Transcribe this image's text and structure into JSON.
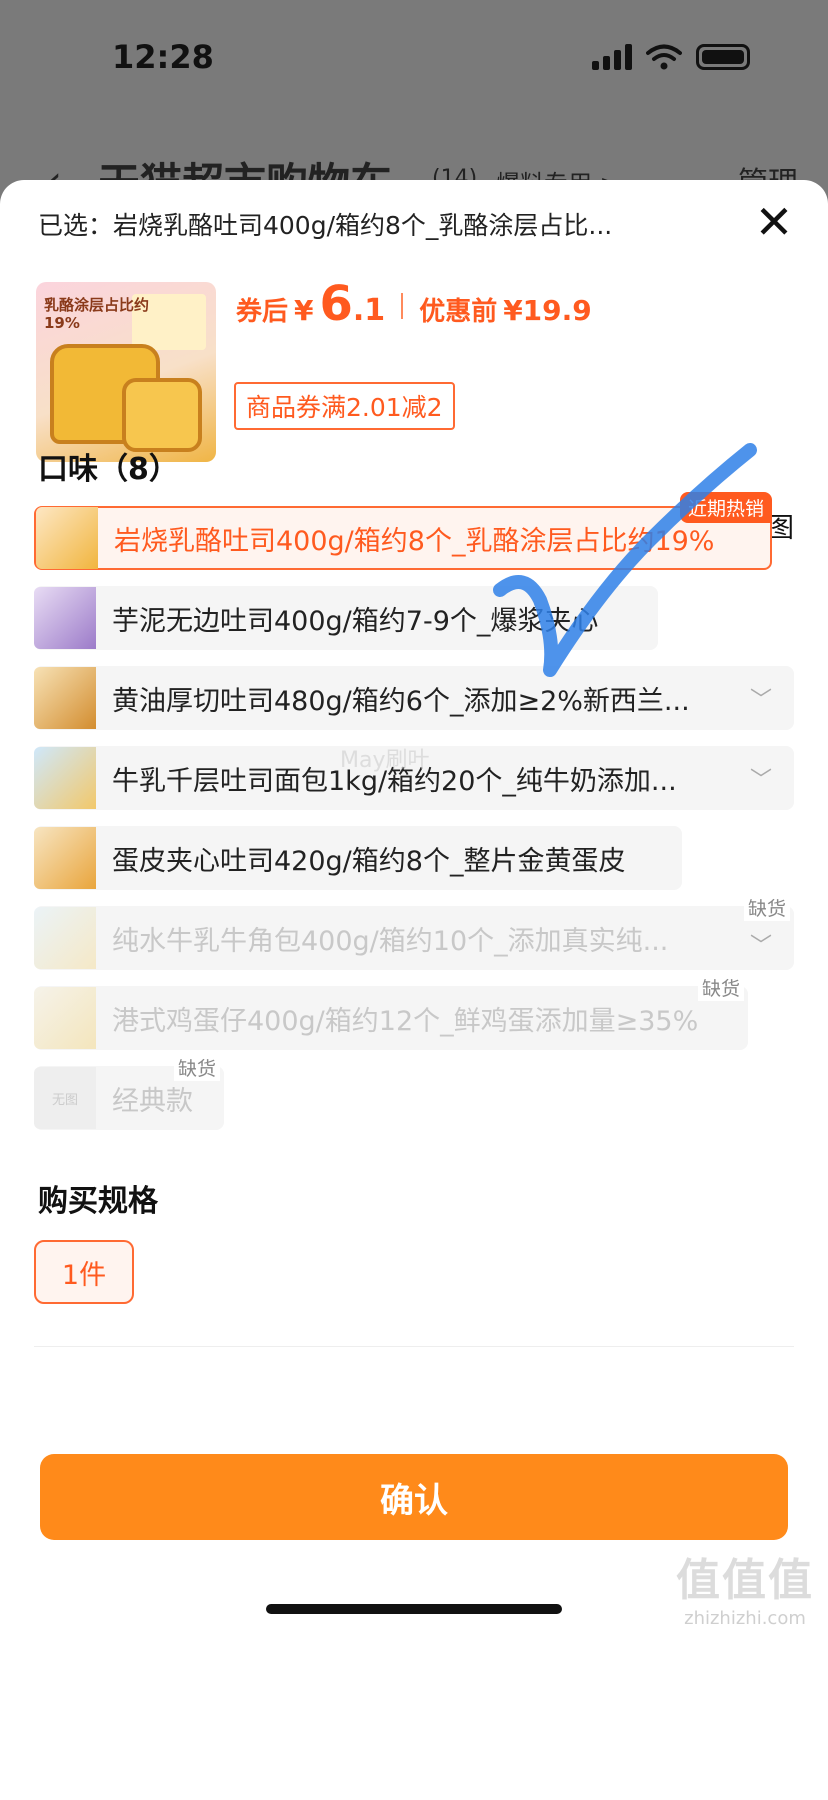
{
  "status_bar": {
    "time": "12:28"
  },
  "background_page": {
    "title": "天猫超市购物车",
    "count": "(14)",
    "location": "爆料专用 >",
    "manage": "管理"
  },
  "sheet": {
    "selected_text": "已选：岩烧乳酪吐司400g/箱约8个_乳酪涂层占比...",
    "close_icon": "close-icon",
    "product_thumb_text": "乳酪涂层占比约19%",
    "price": {
      "after_label": "券后",
      "currency": "¥",
      "after_int": "6",
      "after_dec": ".1",
      "before_label": "优惠前",
      "before_price": "¥19.9"
    },
    "coupon": "商品券满2.01减2",
    "flavor_section": {
      "title": "口味（8）",
      "big_image_label": "大图",
      "options": [
        {
          "label": "岩烧乳酪吐司400g/箱约8个_乳酪涂层占比约19%",
          "badge": "近期热销"
        },
        {
          "label": "芋泥无边吐司400g/箱约7-9个_爆浆夹心"
        },
        {
          "label": "黄油厚切吐司480g/箱约6个_添加≥2%新西兰..."
        },
        {
          "label": "牛乳千层吐司面包1kg/箱约20个_纯牛奶添加..."
        },
        {
          "label": "蛋皮夹心吐司420g/箱约8个_整片金黄蛋皮"
        },
        {
          "label": "纯水牛乳牛角包400g/箱约10个_添加真实纯...",
          "badge": "缺货"
        },
        {
          "label": "港式鸡蛋仔400g/箱约12个_鲜鸡蛋添加量≥35%",
          "badge": "缺货"
        },
        {
          "label": "经典款",
          "badge": "缺货",
          "thumb_text": "无图"
        }
      ]
    },
    "spec_section": {
      "title": "购买规格",
      "option": "1件"
    },
    "confirm_label": "确认"
  },
  "overlays": {
    "watermark": "May刷叶",
    "logo": "值值值",
    "logo_url": "zhizhizhi.com"
  },
  "colors": {
    "accent": "#ff5a1f",
    "confirm": "#ff8a1a"
  }
}
